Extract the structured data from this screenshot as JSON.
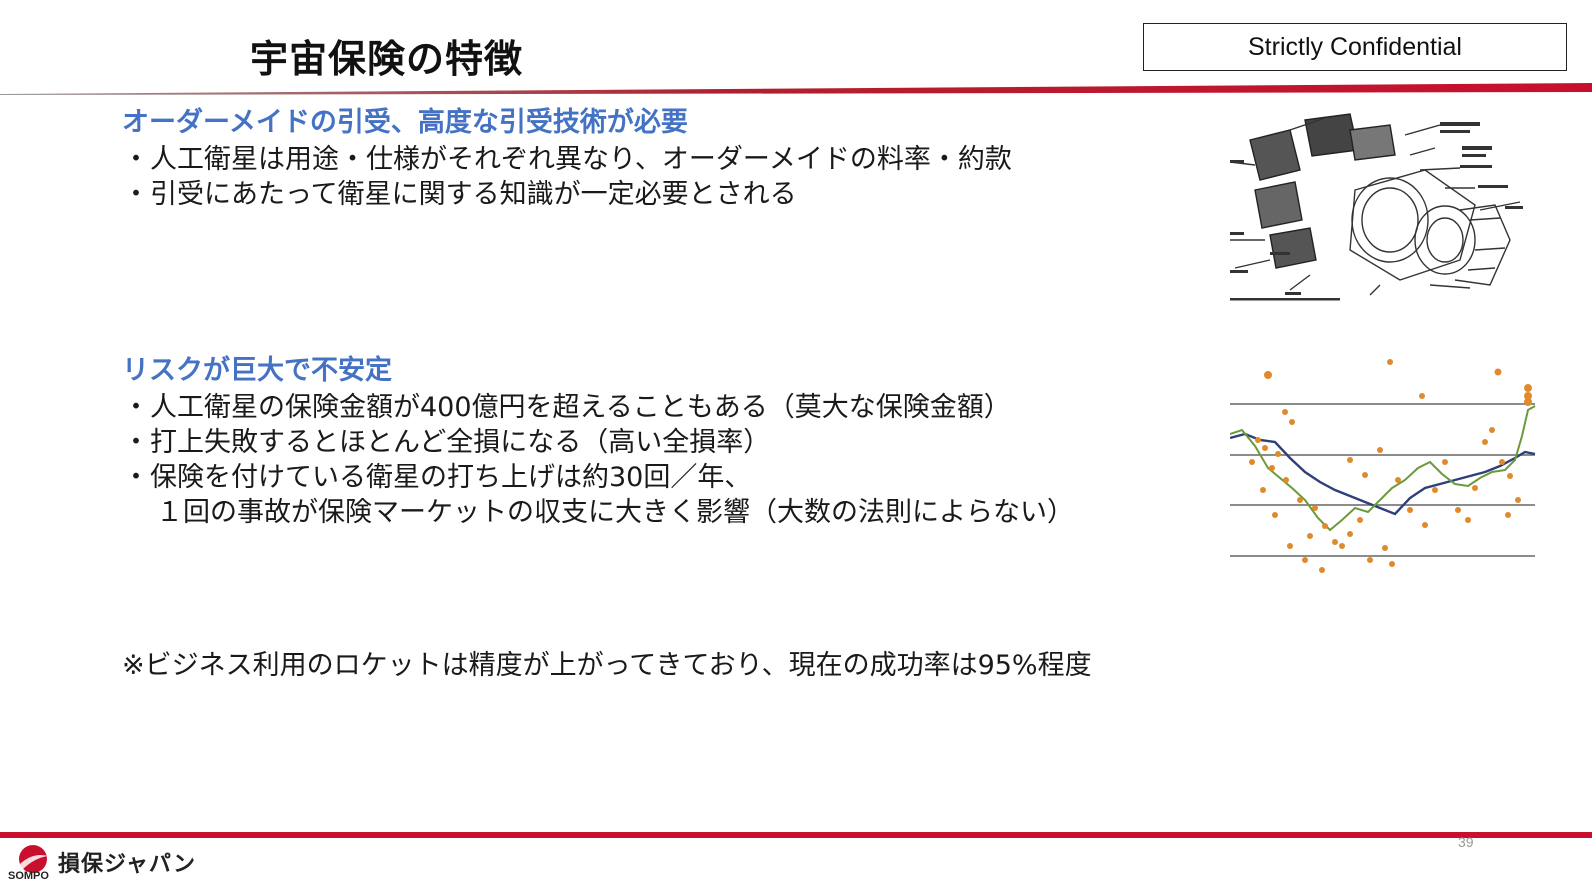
{
  "header": {
    "title": "宇宙保険の特徴",
    "confidential": "Strictly Confidential"
  },
  "sections": [
    {
      "heading": "オーダーメイドの引受、高度な引受技術が必要",
      "bullets": [
        "人工衛星は用途・仕様がそれぞれ異なり、オーダーメイドの料率・約款",
        "引受にあたって衛星に関する知識が一定必要とされる"
      ]
    },
    {
      "heading": "リスクが巨大で不安定",
      "bullets": [
        "人工衛星の保険金額が400億円を超えることもある（莫大な保険金額）",
        "打上失敗するとほとんど全損になる（高い全損率）",
        "保険を付けている衛星の打ち上げは約30回／年、"
      ],
      "continuation": "１回の事故が保険マーケットの収支に大きく影響（大数の法則によらない）"
    }
  ],
  "note": "※ビジネス利用のロケットは精度が上がってきており、現在の成功率は95%程度",
  "footer": {
    "page_number": "39",
    "logo_sompo": "SOMPO",
    "logo_jp": "損保ジャパン"
  },
  "colors": {
    "accent_blue": "#4472c4",
    "brand_red": "#c8102e",
    "scatter_dots": "#e08a2c",
    "line_green": "#6a9a3a",
    "line_navy": "#2e3f7a"
  },
  "icons": {
    "satellite": "satellite-diagram-icon",
    "scatter": "loss-ratio-scatter-icon",
    "logo": "sompo-logo-icon"
  }
}
